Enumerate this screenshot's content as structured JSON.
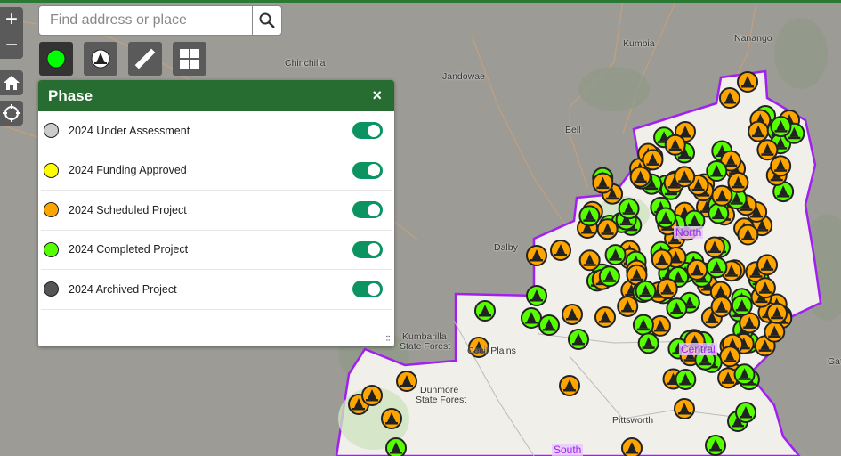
{
  "search": {
    "placeholder": "Find address or place"
  },
  "zoom": {
    "in": "+",
    "out": "−"
  },
  "tools": [
    {
      "icon": "green-dot-icon"
    },
    {
      "icon": "traffic-cone-icon"
    },
    {
      "icon": "ruler-icon"
    },
    {
      "icon": "basemap-grid-icon"
    }
  ],
  "panel": {
    "title": "Phase",
    "close": "×",
    "items": [
      {
        "label": "2024 Under Assessment",
        "color": "#cccccc",
        "on": true
      },
      {
        "label": "2024 Funding Approved",
        "color": "#ffff00",
        "on": true
      },
      {
        "label": "2024 Scheduled Project",
        "color": "#ffa500",
        "on": true
      },
      {
        "label": "2024 Completed Project",
        "color": "#55ff00",
        "on": true
      },
      {
        "label": "2024 Archived Project",
        "color": "#555555",
        "on": true
      }
    ]
  },
  "map": {
    "places": [
      "Chinchilla",
      "Jandowae",
      "Kumbia",
      "Nanango",
      "Bell",
      "Dalby",
      "Kumbarilla",
      "State Forest",
      "Cecil Plains",
      "Dunmore",
      "State Forest",
      "Pittsworth",
      "Gat"
    ],
    "regions": [
      "North",
      "Central",
      "South"
    ],
    "boundary_color": "#a020f0"
  }
}
